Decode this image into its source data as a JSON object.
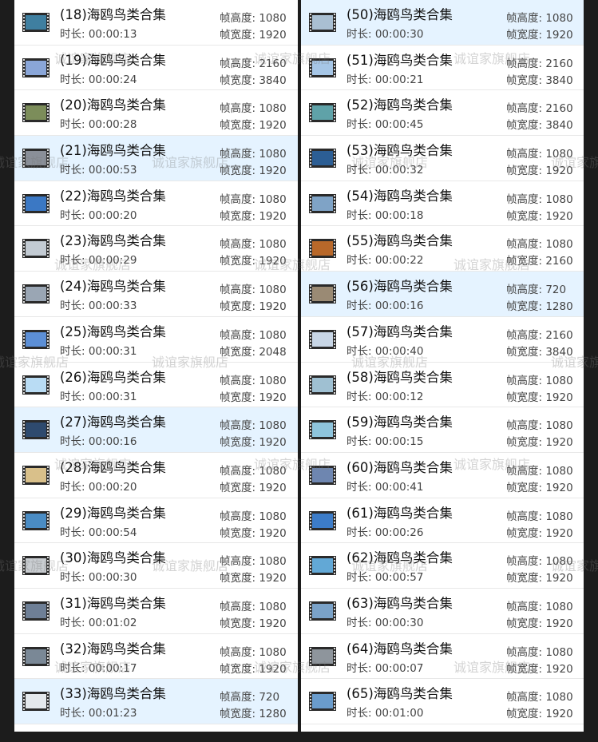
{
  "labels": {
    "duration_prefix": "时长: ",
    "frame_height_prefix": "帧高度: ",
    "frame_width_prefix": "帧宽度: "
  },
  "watermark": "诚谊家旗舰店",
  "left_column": [
    {
      "name": "(18)海鸥鸟类合集",
      "duration": "00:00:13",
      "frame_height": "1080",
      "frame_width": "1920",
      "selected": false,
      "thumb_color": "#3f7fa0"
    },
    {
      "name": "(19)海鸥鸟类合集",
      "duration": "00:00:24",
      "frame_height": "2160",
      "frame_width": "3840",
      "selected": false,
      "thumb_color": "#8aa6d8"
    },
    {
      "name": "(20)海鸥鸟类合集",
      "duration": "00:00:28",
      "frame_height": "1080",
      "frame_width": "1920",
      "selected": false,
      "thumb_color": "#7c8d5a"
    },
    {
      "name": "(21)海鸥鸟类合集",
      "duration": "00:00:53",
      "frame_height": "1080",
      "frame_width": "1920",
      "selected": true,
      "thumb_color": "#8a8f98"
    },
    {
      "name": "(22)海鸥鸟类合集",
      "duration": "00:00:20",
      "frame_height": "1080",
      "frame_width": "1920",
      "selected": false,
      "thumb_color": "#3b78c4"
    },
    {
      "name": "(23)海鸥鸟类合集",
      "duration": "00:00:29",
      "frame_height": "1080",
      "frame_width": "1920",
      "selected": false,
      "thumb_color": "#c3cbd3"
    },
    {
      "name": "(24)海鸥鸟类合集",
      "duration": "00:00:33",
      "frame_height": "1080",
      "frame_width": "1920",
      "selected": false,
      "thumb_color": "#9aa6b4"
    },
    {
      "name": "(25)海鸥鸟类合集",
      "duration": "00:00:31",
      "frame_height": "1080",
      "frame_width": "2048",
      "selected": false,
      "thumb_color": "#5c8fd6"
    },
    {
      "name": "(26)海鸥鸟类合集",
      "duration": "00:00:31",
      "frame_height": "1080",
      "frame_width": "1920",
      "selected": false,
      "thumb_color": "#b9dcf4"
    },
    {
      "name": "(27)海鸥鸟类合集",
      "duration": "00:00:16",
      "frame_height": "1080",
      "frame_width": "1920",
      "selected": true,
      "thumb_color": "#2e4a6e"
    },
    {
      "name": "(28)海鸥鸟类合集",
      "duration": "00:00:20",
      "frame_height": "1080",
      "frame_width": "1920",
      "selected": false,
      "thumb_color": "#d9c08a"
    },
    {
      "name": "(29)海鸥鸟类合集",
      "duration": "00:00:54",
      "frame_height": "1080",
      "frame_width": "1920",
      "selected": false,
      "thumb_color": "#4a8cc4"
    },
    {
      "name": "(30)海鸥鸟类合集",
      "duration": "00:00:30",
      "frame_height": "1080",
      "frame_width": "1920",
      "selected": false,
      "thumb_color": "#c9cdd1"
    },
    {
      "name": "(31)海鸥鸟类合集",
      "duration": "00:01:02",
      "frame_height": "1080",
      "frame_width": "1920",
      "selected": false,
      "thumb_color": "#6e7f96"
    },
    {
      "name": "(32)海鸥鸟类合集",
      "duration": "00:00:17",
      "frame_height": "1080",
      "frame_width": "1920",
      "selected": false,
      "thumb_color": "#7a8896"
    },
    {
      "name": "(33)海鸥鸟类合集",
      "duration": "00:01:23",
      "frame_height": "720",
      "frame_width": "1280",
      "selected": true,
      "thumb_color": "#e4e8ec"
    }
  ],
  "right_column": [
    {
      "name": "(50)海鸥鸟类合集",
      "duration": "00:00:30",
      "frame_height": "1080",
      "frame_width": "1920",
      "selected": true,
      "thumb_color": "#a9bfd2"
    },
    {
      "name": "(51)海鸥鸟类合集",
      "duration": "00:00:21",
      "frame_height": "2160",
      "frame_width": "3840",
      "selected": false,
      "thumb_color": "#a6c6e6"
    },
    {
      "name": "(52)海鸥鸟类合集",
      "duration": "00:00:45",
      "frame_height": "2160",
      "frame_width": "3840",
      "selected": false,
      "thumb_color": "#5fa2a8"
    },
    {
      "name": "(53)海鸥鸟类合集",
      "duration": "00:00:32",
      "frame_height": "1080",
      "frame_width": "1920",
      "selected": false,
      "thumb_color": "#2c5e94"
    },
    {
      "name": "(54)海鸥鸟类合集",
      "duration": "00:00:18",
      "frame_height": "1080",
      "frame_width": "1920",
      "selected": false,
      "thumb_color": "#7fa3c6"
    },
    {
      "name": "(55)海鸥鸟类合集",
      "duration": "00:00:22",
      "frame_height": "1080",
      "frame_width": "2160",
      "selected": false,
      "thumb_color": "#b8682a"
    },
    {
      "name": "(56)海鸥鸟类合集",
      "duration": "00:00:16",
      "frame_height": "720",
      "frame_width": "1280",
      "selected": true,
      "thumb_color": "#9a8a74"
    },
    {
      "name": "(57)海鸥鸟类合集",
      "duration": "00:00:40",
      "frame_height": "2160",
      "frame_width": "3840",
      "selected": false,
      "thumb_color": "#c8d6e6"
    },
    {
      "name": "(58)海鸥鸟类合集",
      "duration": "00:00:12",
      "frame_height": "1080",
      "frame_width": "1920",
      "selected": false,
      "thumb_color": "#9fc0d2"
    },
    {
      "name": "(59)海鸥鸟类合集",
      "duration": "00:00:15",
      "frame_height": "1080",
      "frame_width": "1920",
      "selected": false,
      "thumb_color": "#8ec4dc"
    },
    {
      "name": "(60)海鸥鸟类合集",
      "duration": "00:00:41",
      "frame_height": "1080",
      "frame_width": "1920",
      "selected": false,
      "thumb_color": "#6e86b0"
    },
    {
      "name": "(61)海鸥鸟类合集",
      "duration": "00:00:26",
      "frame_height": "1080",
      "frame_width": "1920",
      "selected": false,
      "thumb_color": "#3c7cc8"
    },
    {
      "name": "(62)海鸥鸟类合集",
      "duration": "00:00:57",
      "frame_height": "1080",
      "frame_width": "1920",
      "selected": false,
      "thumb_color": "#62a8d6"
    },
    {
      "name": "(63)海鸥鸟类合集",
      "duration": "00:00:30",
      "frame_height": "1080",
      "frame_width": "1920",
      "selected": false,
      "thumb_color": "#7aa2c8"
    },
    {
      "name": "(64)海鸥鸟类合集",
      "duration": "00:00:07",
      "frame_height": "1080",
      "frame_width": "1920",
      "selected": false,
      "thumb_color": "#8e959c"
    },
    {
      "name": "(65)海鸥鸟类合集",
      "duration": "00:01:00",
      "frame_height": "1080",
      "frame_width": "1920",
      "selected": false,
      "thumb_color": "#6a9ccc"
    }
  ]
}
